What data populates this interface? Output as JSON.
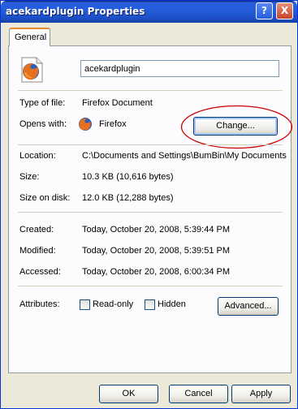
{
  "window": {
    "title": "acekardplugin Properties"
  },
  "titlebar": {
    "help_label": "?",
    "close_label": "X"
  },
  "tabs": [
    {
      "label": "General"
    }
  ],
  "general": {
    "file_name": "acekardplugin",
    "type_label": "Type of file:",
    "type_value": "Firefox Document",
    "opens_label": "Opens with:",
    "opens_value": "Firefox",
    "change_label": "Change...",
    "location_label": "Location:",
    "location_value": "C:\\Documents and Settings\\BumBin\\My Documents",
    "size_label": "Size:",
    "size_value": "10.3 KB (10,616 bytes)",
    "size_on_disk_label": "Size on disk:",
    "size_on_disk_value": "12.0 KB (12,288 bytes)",
    "created_label": "Created:",
    "created_value": "Today, October 20, 2008, 5:39:44 PM",
    "modified_label": "Modified:",
    "modified_value": "Today, October 20, 2008, 5:39:51 PM",
    "accessed_label": "Accessed:",
    "accessed_value": "Today, October 20, 2008, 6:00:34 PM",
    "attributes_label": "Attributes:",
    "readonly_label": "Read-only",
    "hidden_label": "Hidden",
    "advanced_label": "Advanced..."
  },
  "footer": {
    "ok_label": "OK",
    "cancel_label": "Cancel",
    "apply_label": "Apply"
  },
  "icons": {
    "file": "firefox-document-icon",
    "app": "firefox-icon"
  },
  "colors": {
    "titlebar": "#245edb",
    "accent_tab": "#e68b2c",
    "annotation": "#cc0000",
    "dialog_bg": "#ece9d8"
  }
}
